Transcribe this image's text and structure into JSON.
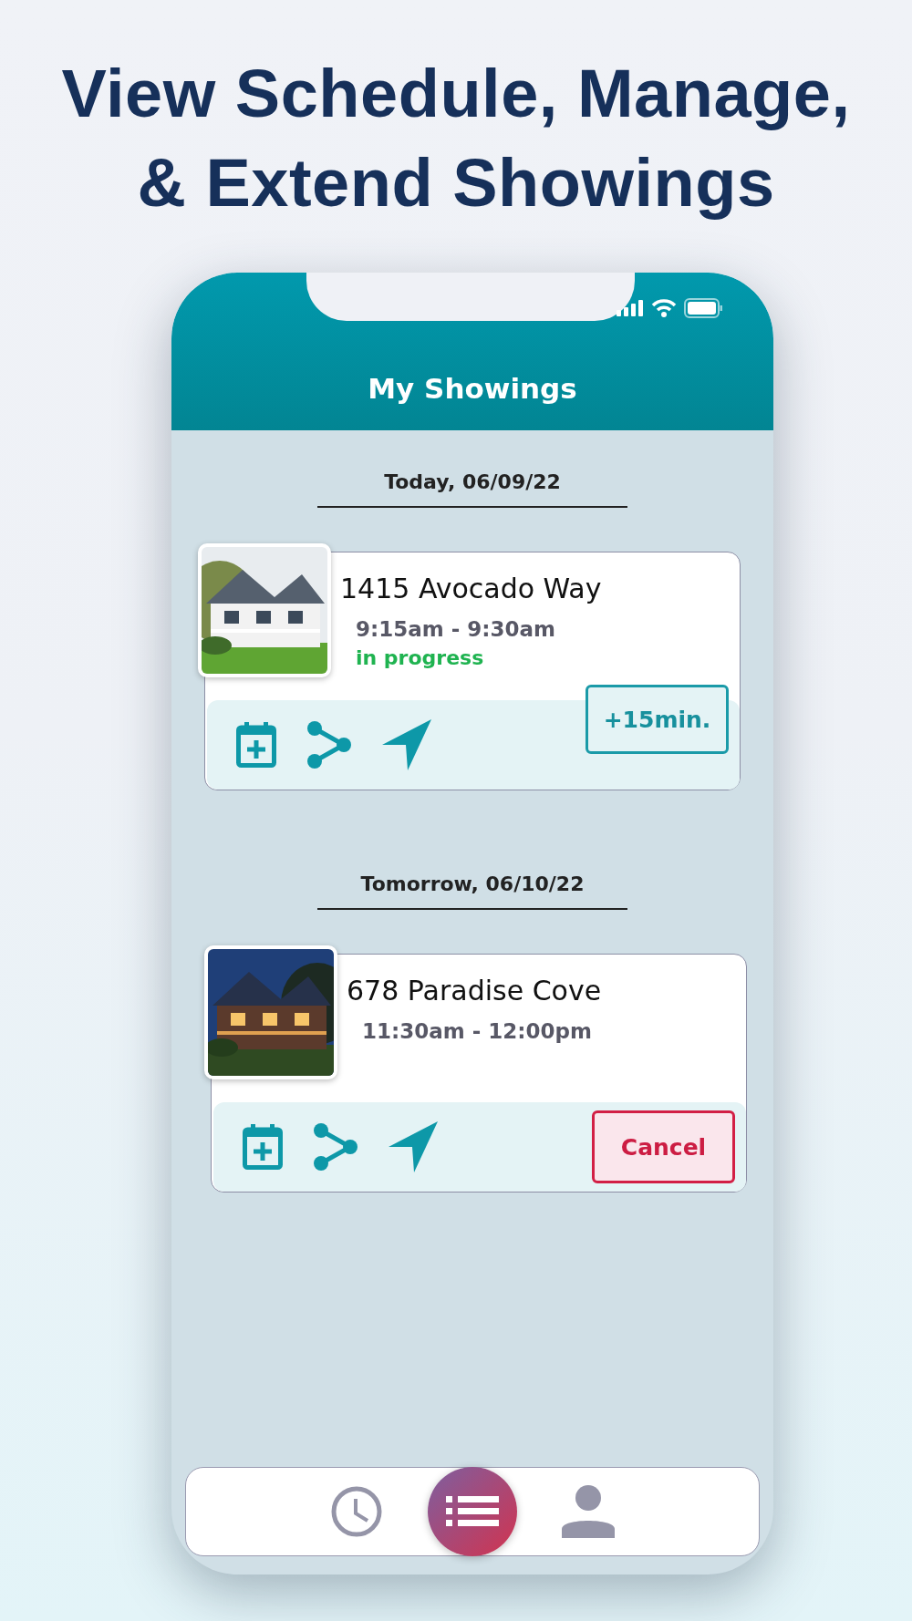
{
  "headline": "View Schedule, Manage,\n& Extend Showings",
  "app": {
    "title": "My Showings",
    "days": [
      {
        "date": "Today, 06/09/22",
        "showings": [
          {
            "address": "1415 Avocado Way",
            "time": "9:15am - 9:30am",
            "status": "in progress",
            "button": {
              "kind": "extend",
              "label": "+15min."
            }
          }
        ]
      },
      {
        "date": "Tomorrow, 06/10/22",
        "showings": [
          {
            "address": "678 Paradise Cove",
            "time": "11:30am - 12:00pm",
            "button": {
              "kind": "cancel",
              "label": "Cancel"
            }
          }
        ]
      }
    ],
    "nav": [
      {
        "kind": "clock",
        "selected": false
      },
      {
        "kind": "list",
        "selected": true
      },
      {
        "kind": "person",
        "selected": false
      }
    ]
  }
}
